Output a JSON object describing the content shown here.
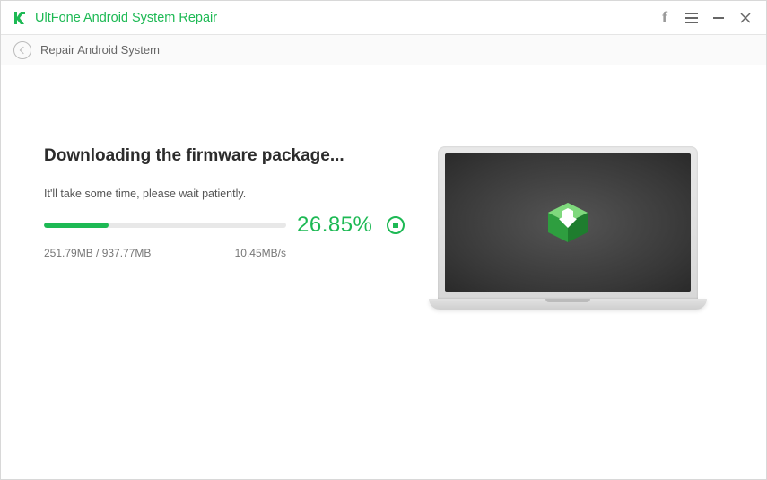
{
  "app": {
    "title": "UltFone Android System Repair"
  },
  "breadcrumb": {
    "label": "Repair Android System"
  },
  "download": {
    "heading": "Downloading the firmware package...",
    "subtext": "It'll take some time, please wait patiently.",
    "percent": "26.85%",
    "percent_value": 26.85,
    "size_status": "251.79MB / 937.77MB",
    "speed": "10.45MB/s"
  },
  "colors": {
    "accent": "#1db954"
  }
}
